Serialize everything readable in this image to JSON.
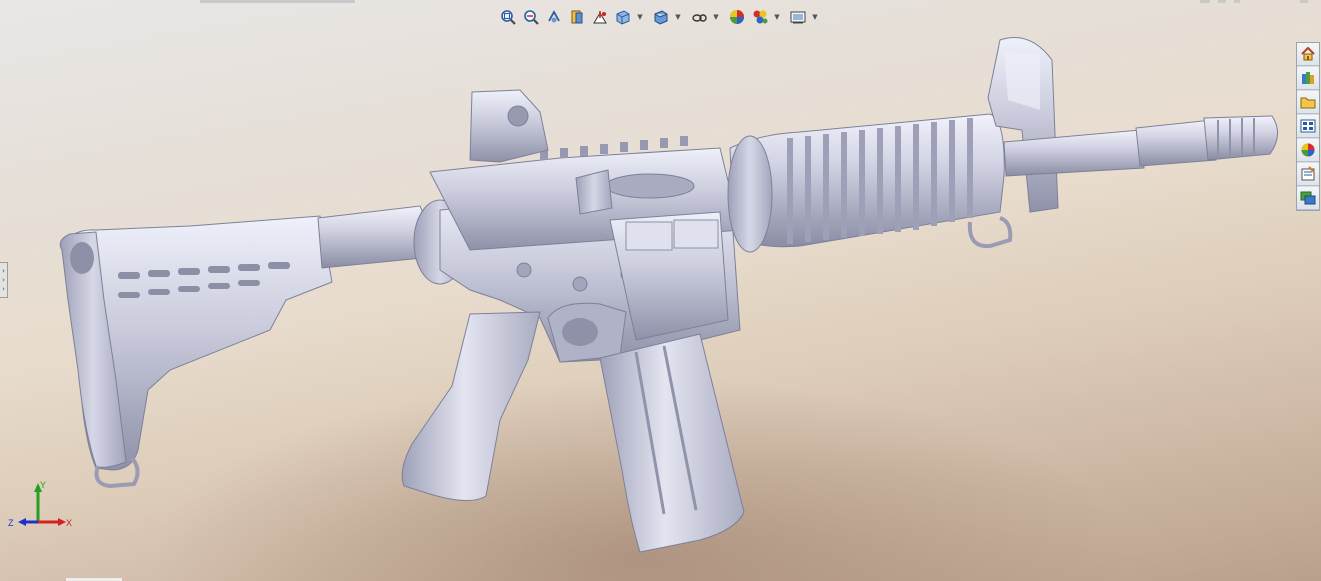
{
  "toolbar": {
    "heads_up_view": [
      {
        "name": "zoom-to-fit",
        "icon": "zoom-to-fit-icon"
      },
      {
        "name": "zoom-to-area",
        "icon": "zoom-to-area-icon"
      },
      {
        "name": "previous-view",
        "icon": "previous-view-icon"
      },
      {
        "name": "section-view",
        "icon": "section-view-icon"
      },
      {
        "name": "dynamic-annotation-views",
        "icon": "dynamic-annotation-icon"
      },
      {
        "name": "view-orientation",
        "icon": "view-orientation-icon",
        "dropdown": true
      },
      {
        "name": "display-style",
        "icon": "display-style-icon",
        "dropdown": true
      },
      {
        "name": "hide-show-items",
        "icon": "hide-show-icon",
        "dropdown": true
      },
      {
        "name": "edit-appearance",
        "icon": "edit-appearance-icon"
      },
      {
        "name": "apply-scene",
        "icon": "apply-scene-icon",
        "dropdown": true
      },
      {
        "name": "view-settings",
        "icon": "view-settings-icon",
        "dropdown": true
      }
    ]
  },
  "task_pane": {
    "tabs": [
      {
        "name": "solidworks-resources",
        "icon": "home-icon"
      },
      {
        "name": "design-library",
        "icon": "design-library-icon"
      },
      {
        "name": "file-explorer",
        "icon": "folder-icon"
      },
      {
        "name": "view-palette",
        "icon": "view-palette-icon"
      },
      {
        "name": "appearances-scenes-decals",
        "icon": "appearances-icon"
      },
      {
        "name": "custom-properties",
        "icon": "custom-properties-icon"
      },
      {
        "name": "solidworks-forum",
        "icon": "forum-icon"
      }
    ]
  },
  "triad": {
    "x": "X",
    "y": "Y",
    "z": "Z"
  },
  "colors": {
    "model": "#c8c9da",
    "model_shadow": "#8f91a8",
    "model_highlight": "#eceef8",
    "triad_x": "#d42020",
    "triad_y": "#22a022",
    "triad_z": "#2030c8"
  }
}
